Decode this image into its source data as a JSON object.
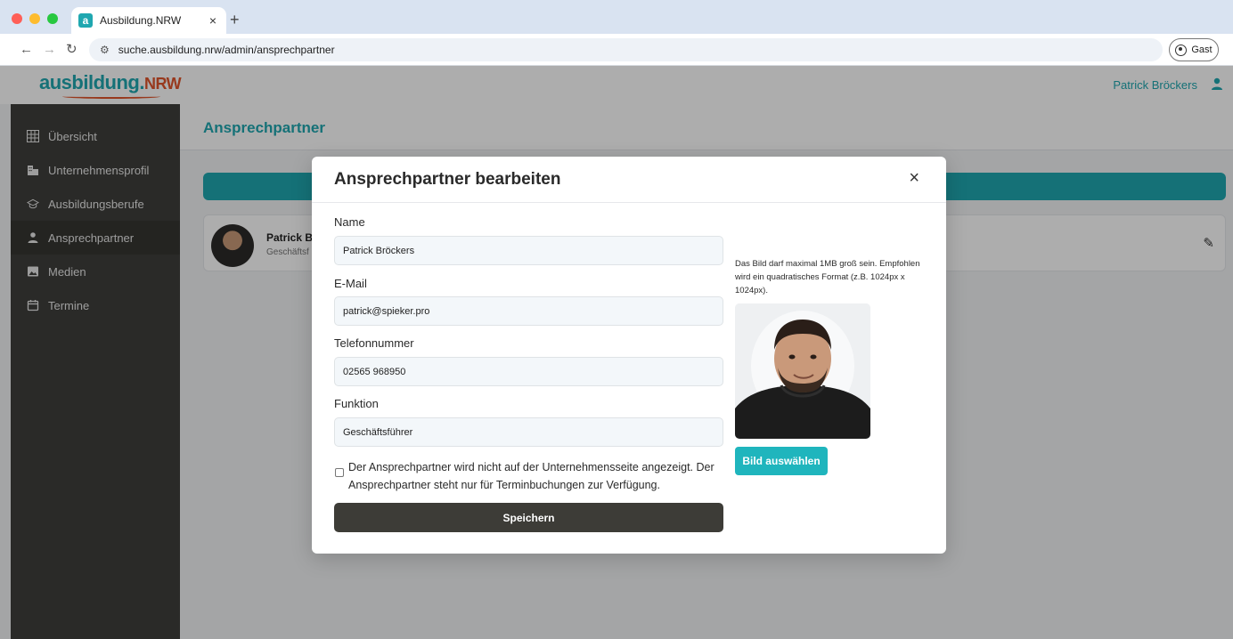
{
  "browser": {
    "tab_title": "Ausbildung.NRW",
    "tab_favicon_letter": "a",
    "tab_close": "×",
    "new_tab": "+",
    "url": "suche.ausbildung.nrw/admin/ansprechpartner",
    "profile_label": "Gast"
  },
  "header": {
    "logo_text": "ausbildung.",
    "logo_suffix": "NRW",
    "user_name": "Patrick Bröckers"
  },
  "sidebar": {
    "items": [
      {
        "label": "Übersicht",
        "icon": "grid-icon"
      },
      {
        "label": "Unternehmensprofil",
        "icon": "building-icon"
      },
      {
        "label": "Ausbildungsberufe",
        "icon": "graduation-cap-icon"
      },
      {
        "label": "Ansprechpartner",
        "icon": "person-icon",
        "active": true
      },
      {
        "label": "Medien",
        "icon": "image-icon"
      },
      {
        "label": "Termine",
        "icon": "calendar-icon"
      }
    ]
  },
  "page": {
    "title": "Ansprechpartner",
    "card": {
      "name": "Patrick Br",
      "role": "Geschäftsf"
    }
  },
  "modal": {
    "title": "Ansprechpartner bearbeiten",
    "close": "×",
    "fields": {
      "name": {
        "label": "Name",
        "value": "Patrick Bröckers"
      },
      "email": {
        "label": "E-Mail",
        "value": "patrick@spieker.pro"
      },
      "phone": {
        "label": "Telefonnummer",
        "value": "02565 968950"
      },
      "function": {
        "label": "Funktion",
        "value": "Geschäftsführer"
      }
    },
    "checkbox_label": "Der Ansprechpartner wird nicht auf der Unternehmensseite angezeigt. Der Ansprechpartner steht nur für Terminbuchungen zur Verfügung.",
    "checkbox_checked": false,
    "save_label": "Speichern",
    "image_hint": "Das Bild darf maximal 1MB groß sein. Empfohlen wird ein quadratisches Format (z.B. 1024px x 1024px).",
    "choose_image_label": "Bild auswählen"
  },
  "colors": {
    "accent": "#1fa7b0",
    "logo_orange": "#e0552b",
    "sidebar_bg": "#3f3f3c",
    "save_button": "#3d3c37"
  }
}
